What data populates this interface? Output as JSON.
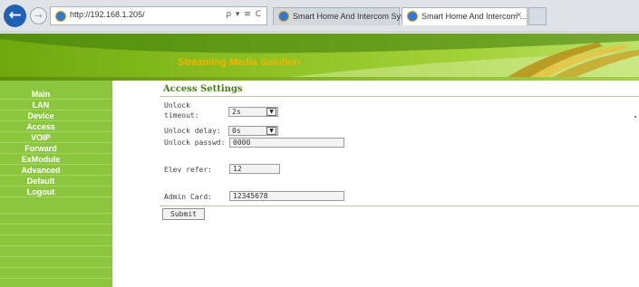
{
  "browser": {
    "back_glyph": "←",
    "forward_glyph": "→",
    "address": "http://192.168.1.205/",
    "address_icons": "ρ ▾ ≡ C",
    "tabs": [
      {
        "label": "Smart Home And Intercom Sys...",
        "active": false
      },
      {
        "label": "Smart Home And Intercom ...",
        "active": true,
        "close": "×"
      }
    ]
  },
  "banner": {
    "title": "Streaming Media Solution"
  },
  "sidebar": {
    "items": [
      {
        "label": "Main"
      },
      {
        "label": "LAN"
      },
      {
        "label": "Device"
      },
      {
        "label": "Access"
      },
      {
        "label": "VOIP"
      },
      {
        "label": "Forward"
      },
      {
        "label": "ExModule"
      },
      {
        "label": "Advanced"
      },
      {
        "label": "Default"
      },
      {
        "label": "Logout"
      }
    ]
  },
  "main": {
    "title": "Access Settings",
    "unlock_timeout": {
      "label_line1": "Unlock",
      "label_line2": "timeout:",
      "value": "2s"
    },
    "unlock_delay": {
      "label": "Unlock delay:",
      "value": "0s"
    },
    "unlock_passwd": {
      "label": "Unlock passwd:",
      "value": "0000"
    },
    "elev_refer": {
      "label": "Elev refer:",
      "value": "12"
    },
    "admin_card": {
      "label": "Admin Card:",
      "value": "12345678"
    },
    "submit_label": "Submit",
    "dropdown_glyph": "▼"
  },
  "colors": {
    "sidebar": "#8cc63f",
    "banner_title": "#f0b400",
    "page_title": "#4b7d16",
    "browser_back": "#1f5fb5"
  }
}
